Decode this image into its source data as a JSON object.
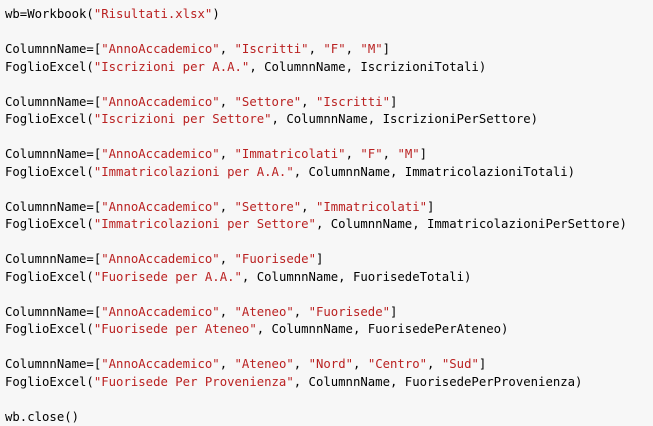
{
  "colors": {
    "background": "#f7f7f7",
    "text": "#000000",
    "string": "#ba2121"
  },
  "lines": [
    [
      {
        "t": "id",
        "v": "wb=Workbook("
      },
      {
        "t": "str",
        "v": "\"Risultati.xlsx\""
      },
      {
        "t": "id",
        "v": ")"
      }
    ],
    [],
    [
      {
        "t": "id",
        "v": "ColumnnName=["
      },
      {
        "t": "str",
        "v": "\"AnnoAccademico\""
      },
      {
        "t": "id",
        "v": ", "
      },
      {
        "t": "str",
        "v": "\"Iscritti\""
      },
      {
        "t": "id",
        "v": ", "
      },
      {
        "t": "str",
        "v": "\"F\""
      },
      {
        "t": "id",
        "v": ", "
      },
      {
        "t": "str",
        "v": "\"M\""
      },
      {
        "t": "id",
        "v": "]"
      }
    ],
    [
      {
        "t": "id",
        "v": "FoglioExcel("
      },
      {
        "t": "str",
        "v": "\"Iscrizioni per A.A.\""
      },
      {
        "t": "id",
        "v": ", ColumnnName, IscrizioniTotali)"
      }
    ],
    [],
    [
      {
        "t": "id",
        "v": "ColumnnName=["
      },
      {
        "t": "str",
        "v": "\"AnnoAccademico\""
      },
      {
        "t": "id",
        "v": ", "
      },
      {
        "t": "str",
        "v": "\"Settore\""
      },
      {
        "t": "id",
        "v": ", "
      },
      {
        "t": "str",
        "v": "\"Iscritti\""
      },
      {
        "t": "id",
        "v": "]"
      }
    ],
    [
      {
        "t": "id",
        "v": "FoglioExcel("
      },
      {
        "t": "str",
        "v": "\"Iscrizioni per Settore\""
      },
      {
        "t": "id",
        "v": ", ColumnnName, IscrizioniPerSettore)"
      }
    ],
    [],
    [
      {
        "t": "id",
        "v": "ColumnnName=["
      },
      {
        "t": "str",
        "v": "\"AnnoAccademico\""
      },
      {
        "t": "id",
        "v": ", "
      },
      {
        "t": "str",
        "v": "\"Immatricolati\""
      },
      {
        "t": "id",
        "v": ", "
      },
      {
        "t": "str",
        "v": "\"F\""
      },
      {
        "t": "id",
        "v": ", "
      },
      {
        "t": "str",
        "v": "\"M\""
      },
      {
        "t": "id",
        "v": "]"
      }
    ],
    [
      {
        "t": "id",
        "v": "FoglioExcel("
      },
      {
        "t": "str",
        "v": "\"Immatricolazioni per A.A.\""
      },
      {
        "t": "id",
        "v": ", ColumnnName, ImmatricolazioniTotali)"
      }
    ],
    [],
    [
      {
        "t": "id",
        "v": "ColumnnName=["
      },
      {
        "t": "str",
        "v": "\"AnnoAccademico\""
      },
      {
        "t": "id",
        "v": ", "
      },
      {
        "t": "str",
        "v": "\"Settore\""
      },
      {
        "t": "id",
        "v": ", "
      },
      {
        "t": "str",
        "v": "\"Immatricolati\""
      },
      {
        "t": "id",
        "v": "]"
      }
    ],
    [
      {
        "t": "id",
        "v": "FoglioExcel("
      },
      {
        "t": "str",
        "v": "\"Immatricolazioni per Settore\""
      },
      {
        "t": "id",
        "v": ", ColumnnName, ImmatricolazioniPerSettore)"
      }
    ],
    [],
    [
      {
        "t": "id",
        "v": "ColumnnName=["
      },
      {
        "t": "str",
        "v": "\"AnnoAccademico\""
      },
      {
        "t": "id",
        "v": ", "
      },
      {
        "t": "str",
        "v": "\"Fuorisede\""
      },
      {
        "t": "id",
        "v": "]"
      }
    ],
    [
      {
        "t": "id",
        "v": "FoglioExcel("
      },
      {
        "t": "str",
        "v": "\"Fuorisede per A.A.\""
      },
      {
        "t": "id",
        "v": ", ColumnnName, FuorisedeTotali)"
      }
    ],
    [],
    [
      {
        "t": "id",
        "v": "ColumnnName=["
      },
      {
        "t": "str",
        "v": "\"AnnoAccademico\""
      },
      {
        "t": "id",
        "v": ", "
      },
      {
        "t": "str",
        "v": "\"Ateneo\""
      },
      {
        "t": "id",
        "v": ", "
      },
      {
        "t": "str",
        "v": "\"Fuorisede\""
      },
      {
        "t": "id",
        "v": "]"
      }
    ],
    [
      {
        "t": "id",
        "v": "FoglioExcel("
      },
      {
        "t": "str",
        "v": "\"Fuorisede per Ateneo\""
      },
      {
        "t": "id",
        "v": ", ColumnnName, FuorisedePerAteneo)"
      }
    ],
    [],
    [
      {
        "t": "id",
        "v": "ColumnnName=["
      },
      {
        "t": "str",
        "v": "\"AnnoAccademico\""
      },
      {
        "t": "id",
        "v": ", "
      },
      {
        "t": "str",
        "v": "\"Ateneo\""
      },
      {
        "t": "id",
        "v": ", "
      },
      {
        "t": "str",
        "v": "\"Nord\""
      },
      {
        "t": "id",
        "v": ", "
      },
      {
        "t": "str",
        "v": "\"Centro\""
      },
      {
        "t": "id",
        "v": ", "
      },
      {
        "t": "str",
        "v": "\"Sud\""
      },
      {
        "t": "id",
        "v": "]"
      }
    ],
    [
      {
        "t": "id",
        "v": "FoglioExcel("
      },
      {
        "t": "str",
        "v": "\"Fuorisede Per Provenienza\""
      },
      {
        "t": "id",
        "v": ", ColumnnName, FuorisedePerProvenienza)"
      }
    ],
    [],
    [
      {
        "t": "id",
        "v": "wb.close()"
      }
    ]
  ]
}
